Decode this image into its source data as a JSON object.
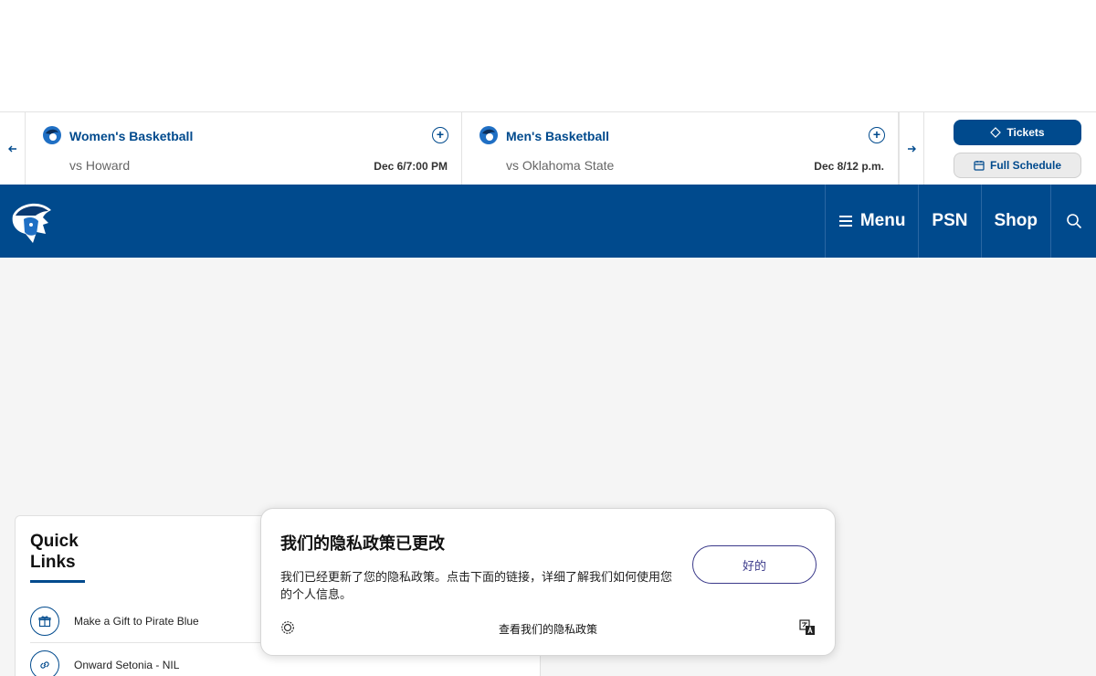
{
  "ticker": {
    "games": [
      {
        "sport": "Women's Basketball",
        "opponent": "vs Howard",
        "date": "Dec 6/7:00 PM"
      },
      {
        "sport": "Men's Basketball",
        "opponent": "vs Oklahoma State",
        "date": "Dec 8/12 p.m."
      }
    ],
    "tickets_label": "Tickets",
    "full_schedule_label": "Full Schedule"
  },
  "nav": {
    "items": [
      {
        "label": "Menu"
      },
      {
        "label": "PSN"
      },
      {
        "label": "Shop"
      }
    ]
  },
  "quick_links": {
    "title": "Quick Links",
    "items": [
      {
        "label": "Make a Gift to Pirate Blue",
        "icon": "gift-icon"
      },
      {
        "label": "Onward Setonia - NIL",
        "icon": "link-icon"
      }
    ]
  },
  "privacy_popup": {
    "title": "我们的隐私政策已更改",
    "text": "我们已经更新了您的隐私政策。点击下面的链接，详细了解我们如何使用您的个人信息。",
    "ok_label": "好的",
    "link_label": "查看我们的隐私政策"
  },
  "colors": {
    "primary": "#004a8d",
    "popup_accent": "#3b3a8a"
  }
}
